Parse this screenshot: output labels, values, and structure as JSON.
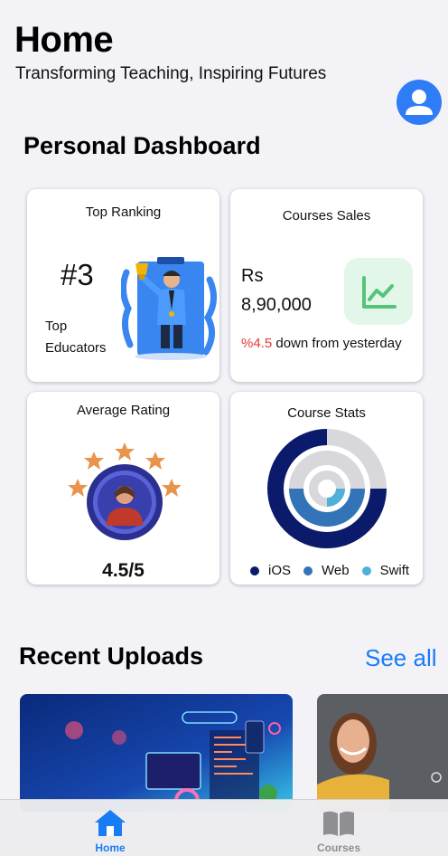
{
  "header": {
    "title": "Home",
    "subtitle": "Transforming Teaching, Inspiring Futures",
    "avatar_icon": "person-icon",
    "accent": "#2e7cf6"
  },
  "dashboard": {
    "title": "Personal Dashboard",
    "top_ranking": {
      "title": "Top Ranking",
      "rank": "#3",
      "label_line1": "Top",
      "label_line2": "Educators"
    },
    "course_sales": {
      "title": "Courses Sales",
      "currency": "Rs",
      "amount": "8,90,000",
      "change_pct": "%4.5",
      "change_text": " down from yesterday",
      "icon": "line-chart-icon"
    },
    "average_rating": {
      "title": "Average Rating",
      "value": "4.5/5",
      "stars": 5
    },
    "course_stats": {
      "title": "Course Stats",
      "legend": [
        {
          "name": "iOS",
          "color": "#0b1a6b"
        },
        {
          "name": "Web",
          "color": "#3373b8"
        },
        {
          "name": "Swift",
          "color": "#4fb0d8"
        }
      ]
    }
  },
  "recent_uploads": {
    "title": "Recent Uploads",
    "see_all": "See all"
  },
  "tabbar": {
    "tabs": [
      {
        "label": "Home",
        "icon": "house-icon",
        "active": true,
        "color": "#1a7cf5"
      },
      {
        "label": "Courses",
        "icon": "book-icon",
        "active": false,
        "color": "#8e8e93"
      }
    ]
  }
}
